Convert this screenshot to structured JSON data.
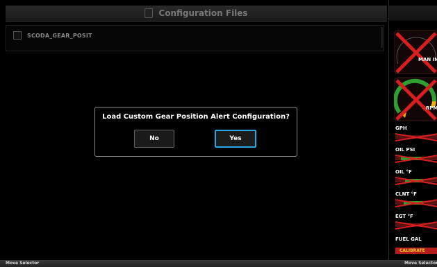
{
  "title_bar": {
    "title": "Configuration Files"
  },
  "file_list": {
    "items": [
      {
        "name": "SCODA_GEAR_POSIT",
        "checked": false
      }
    ]
  },
  "dialog": {
    "message": "Load Custom Gear Position Alert Configuration?",
    "no_label": "No",
    "yes_label": "Yes",
    "selected": "Yes"
  },
  "softkeys": {
    "left_label": "Move Selector",
    "right_label": "Move Selector"
  },
  "engine_strip": {
    "man_in_label": "MAN IN",
    "rpm_label": "RPM",
    "gph_label": "GPH",
    "oil_psi_label": "OIL PSI",
    "oil_temp_label": "OIL °F",
    "clnt_label": "CLNT °F",
    "egt_label": "EGT °F",
    "fuel_label": "FUEL GAL",
    "calibrate_label": "CALIBRATE"
  },
  "colors": {
    "accent_selected": "#28a8e8",
    "invalid_red": "#d81e1e",
    "arc_green": "#2e9e2e",
    "calibrate_text": "#f5d020"
  }
}
